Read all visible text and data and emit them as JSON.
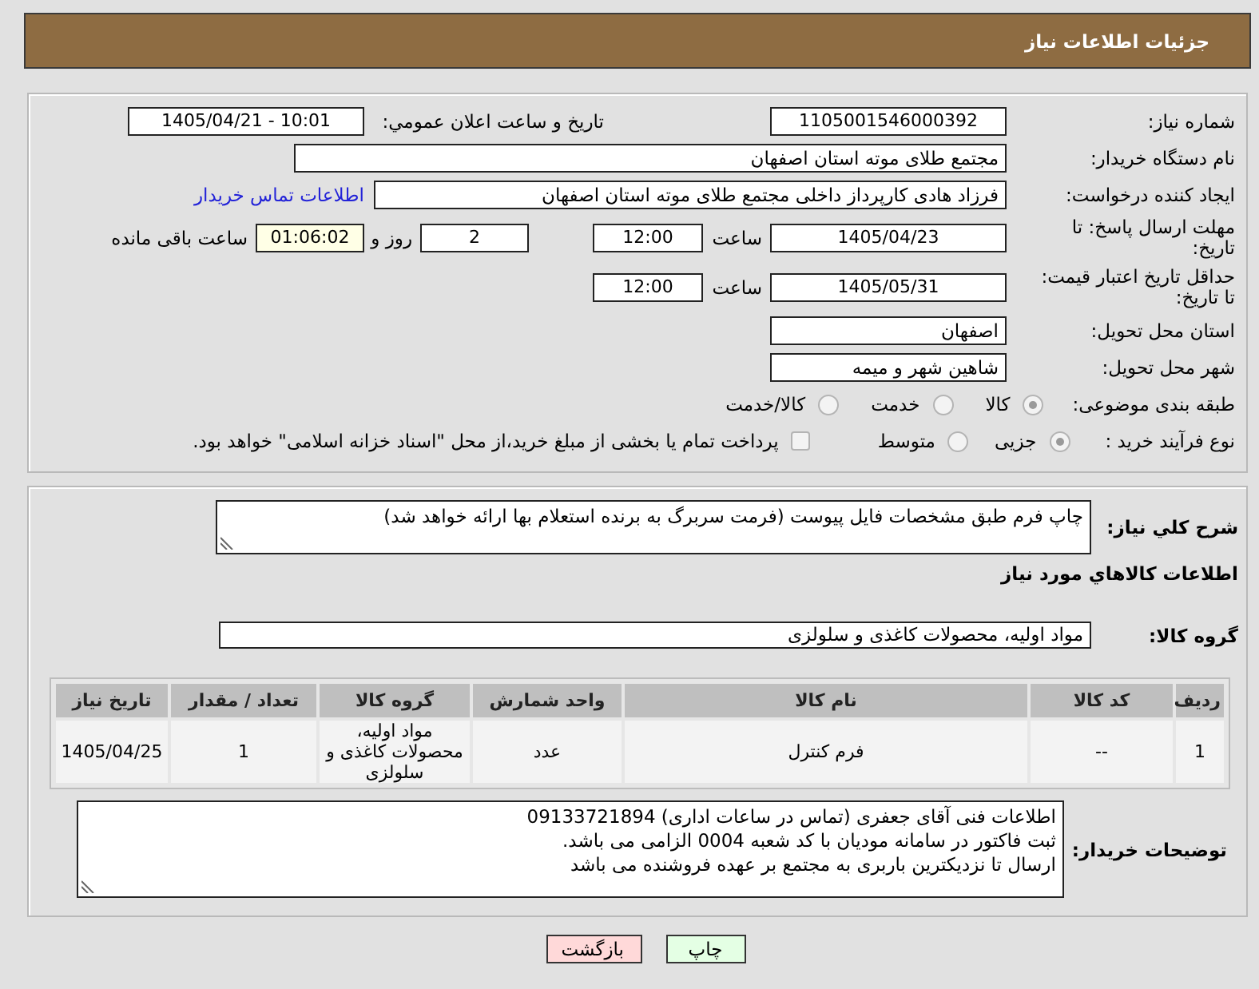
{
  "header": {
    "title": "جزئیات اطلاعات نیاز"
  },
  "details": {
    "need_number": {
      "label": "شماره نیاز:",
      "value": "1105001546000392"
    },
    "announce": {
      "label": "تاریخ و ساعت اعلان عمومي:",
      "value": "1405/04/21 - 10:01"
    },
    "buyer_org": {
      "label": "نام دستگاه خریدار:",
      "value": "مجتمع طلای موته استان اصفهان"
    },
    "requester": {
      "label": "ایجاد کننده درخواست:",
      "value": "فرزاد هادی کارپرداز داخلی مجتمع طلای موته استان اصفهان",
      "link": "اطلاعات تماس خریدار"
    },
    "response_deadline": {
      "label": "مهلت ارسال پاسخ: تا تاریخ:",
      "date": "1405/04/23",
      "time_label": "ساعت",
      "time": "12:00",
      "days": "2",
      "days_label": "روز و",
      "remaining": "01:06:02",
      "remaining_label": "ساعت باقی مانده"
    },
    "price_validity": {
      "label": "حداقل تاریخ اعتبار قیمت: تا تاریخ:",
      "date": "1405/05/31",
      "time_label": "ساعت",
      "time": "12:00"
    },
    "delivery_province": {
      "label": "استان محل تحویل:",
      "value": "اصفهان"
    },
    "delivery_city": {
      "label": "شهر محل تحویل:",
      "value": "شاهین شهر و میمه"
    },
    "category": {
      "label": "طبقه بندی موضوعی:",
      "disabled": true,
      "options": [
        {
          "label": "کالا",
          "selected": true
        },
        {
          "label": "خدمت",
          "selected": false
        },
        {
          "label": "کالا/خدمت",
          "selected": false
        }
      ]
    },
    "purchase_process": {
      "label": "نوع فرآیند خرید :",
      "disabled": true,
      "options": [
        {
          "label": "جزیی",
          "selected": true
        },
        {
          "label": "متوسط",
          "selected": false
        }
      ],
      "treasury_payment": {
        "label": "پرداخت تمام یا بخشی از مبلغ خرید،از محل \"اسناد خزانه اسلامی\" خواهد بود.",
        "checked": false
      }
    }
  },
  "requirements": {
    "summary": {
      "label": "شرح کلي نیاز:",
      "value": "چاپ فرم طبق مشخصات فایل پیوست (فرمت سربرگ به برنده استعلام بها ارائه خواهد شد)"
    },
    "goods_heading": "اطلاعات کالاهاي مورد نیاز",
    "goods_group": {
      "label": "گروه کالا:",
      "value": "مواد اولیه، محصولات کاغذی و سلولزی"
    },
    "table": {
      "columns": [
        "ردیف",
        "کد کالا",
        "نام کالا",
        "واحد شمارش",
        "گروه کالا",
        "تعداد / مقدار",
        "تاریخ نیاز"
      ],
      "rows": [
        [
          "1",
          "--",
          "فرم کنترل",
          "عدد",
          "مواد اولیه، محصولات کاغذی و سلولزی",
          "1",
          "1405/04/25"
        ]
      ]
    },
    "buyer_notes": {
      "label": "توضیحات خریدار:",
      "value": "اطلاعات فنی آقای جعفری (تماس در ساعات اداری) 09133721894\nثبت فاکتور در سامانه مودیان با کد شعبه 0004 الزامی می باشد.\nارسال تا نزدیکترین باربری به مجتمع بر عهده فروشنده می باشد"
    }
  },
  "buttons": [
    {
      "label": "چاپ",
      "kind": "print"
    },
    {
      "label": "بازگشت",
      "kind": "back"
    }
  ]
}
